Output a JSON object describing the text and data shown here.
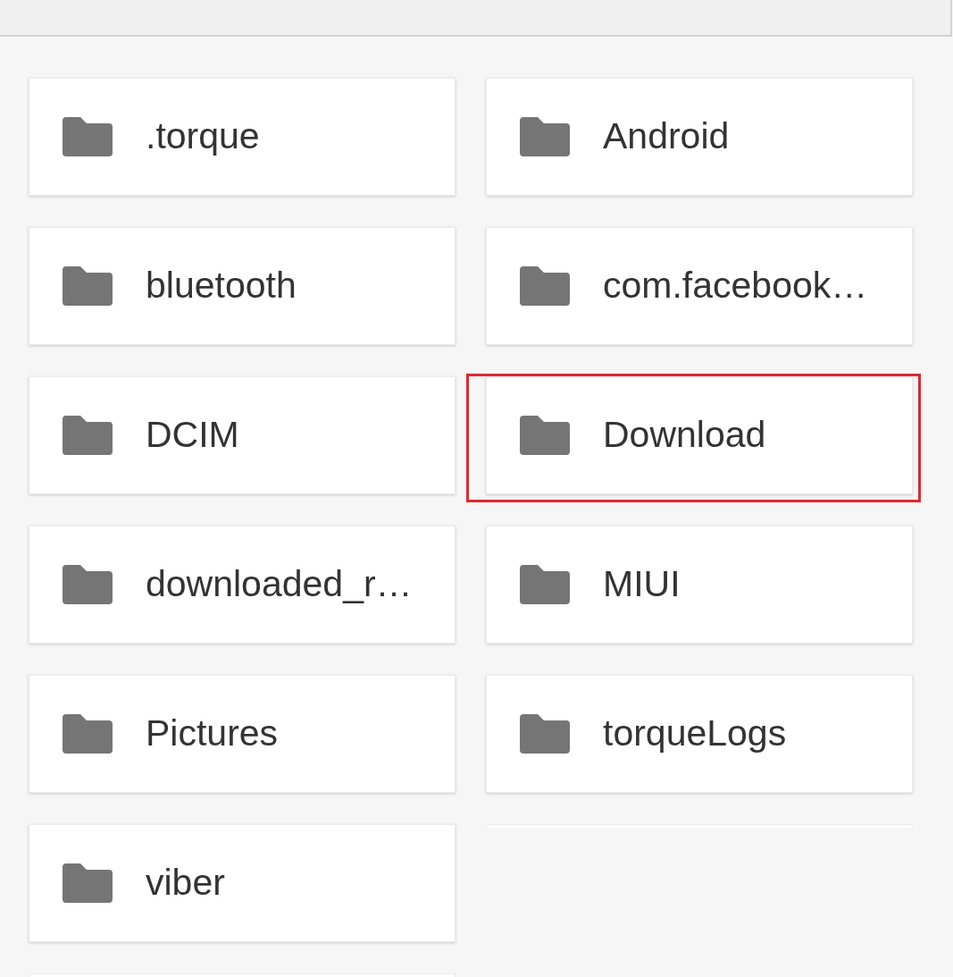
{
  "folders": [
    {
      "kind": "folder",
      "name": ".torque",
      "highlighted": false
    },
    {
      "kind": "folder",
      "name": "Android",
      "highlighted": false
    },
    {
      "kind": "folder",
      "name": "bluetooth",
      "highlighted": false
    },
    {
      "kind": "folder",
      "name": "com.facebook…",
      "highlighted": false
    },
    {
      "kind": "folder",
      "name": "DCIM",
      "highlighted": false
    },
    {
      "kind": "folder",
      "name": "Download",
      "highlighted": true
    },
    {
      "kind": "folder",
      "name": "downloaded_r…",
      "highlighted": false
    },
    {
      "kind": "folder",
      "name": "MIUI",
      "highlighted": false
    },
    {
      "kind": "folder",
      "name": "Pictures",
      "highlighted": false
    },
    {
      "kind": "folder",
      "name": "torqueLogs",
      "highlighted": false
    },
    {
      "kind": "folder",
      "name": "viber",
      "highlighted": false
    },
    {
      "kind": "cut-off",
      "highlighted": false
    },
    {
      "kind": "cut-off",
      "highlighted": false
    }
  ]
}
